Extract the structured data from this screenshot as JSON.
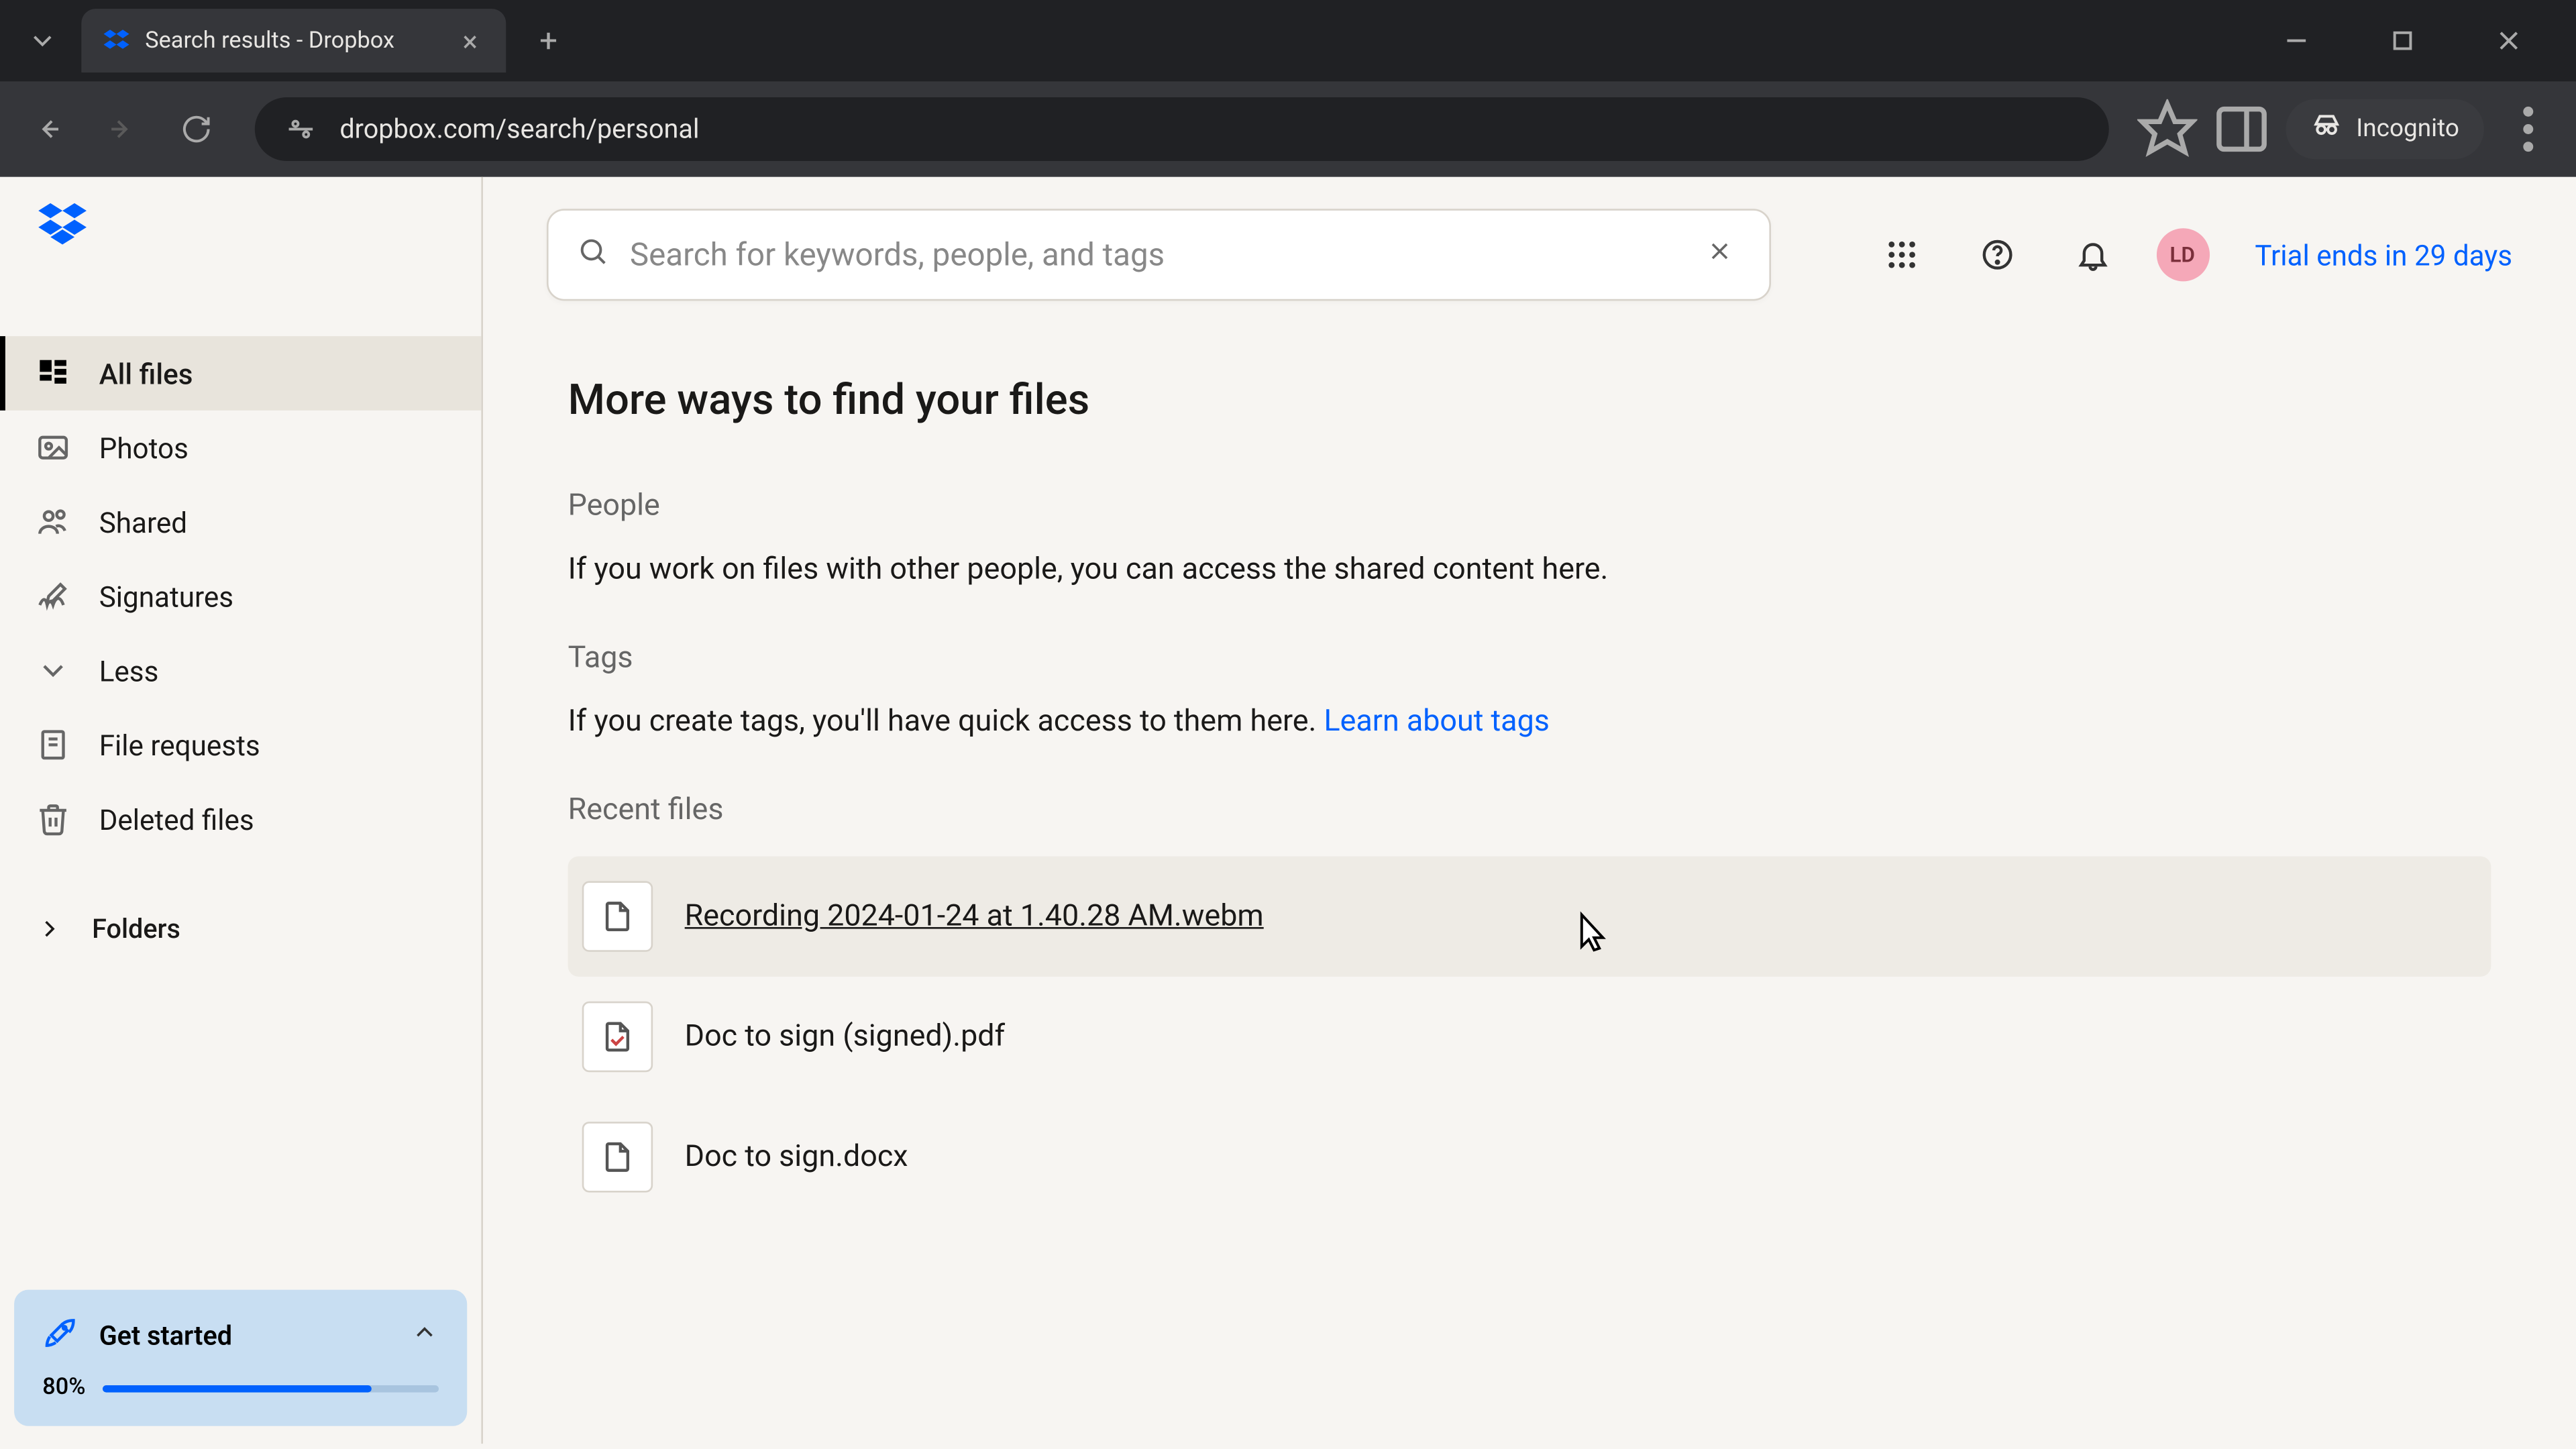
{
  "browser": {
    "tab_title": "Search results - Dropbox",
    "url_display": "dropbox.com/search/personal",
    "incognito_label": "Incognito"
  },
  "sidebar": {
    "items": [
      {
        "label": "All files",
        "icon": "all-files"
      },
      {
        "label": "Photos",
        "icon": "photos"
      },
      {
        "label": "Shared",
        "icon": "shared"
      },
      {
        "label": "Signatures",
        "icon": "signatures"
      },
      {
        "label": "Less",
        "icon": "less"
      },
      {
        "label": "File requests",
        "icon": "file-requests"
      },
      {
        "label": "Deleted files",
        "icon": "deleted"
      }
    ],
    "folders_label": "Folders",
    "get_started": {
      "title": "Get started",
      "percent": "80%",
      "fill": 80
    }
  },
  "search": {
    "placeholder": "Search for keywords, people, and tags"
  },
  "header": {
    "avatar": "LD",
    "trial_text": "Trial ends in 29 days"
  },
  "content": {
    "title": "More ways to find your files",
    "people_label": "People",
    "people_desc": "If you work on files with other people, you can access the shared content here.",
    "tags_label": "Tags",
    "tags_desc_prefix": "If you create tags, you'll have quick access to them here. ",
    "tags_link": "Learn about tags",
    "recent_label": "Recent files",
    "recent_files": [
      {
        "name": "Recording 2024-01-24 at 1.40.28 AM.webm",
        "icon": "file",
        "hovered": true
      },
      {
        "name": "Doc to sign (signed).pdf",
        "icon": "pdf",
        "hovered": false
      },
      {
        "name": "Doc to sign.docx",
        "icon": "file",
        "hovered": false
      }
    ]
  }
}
